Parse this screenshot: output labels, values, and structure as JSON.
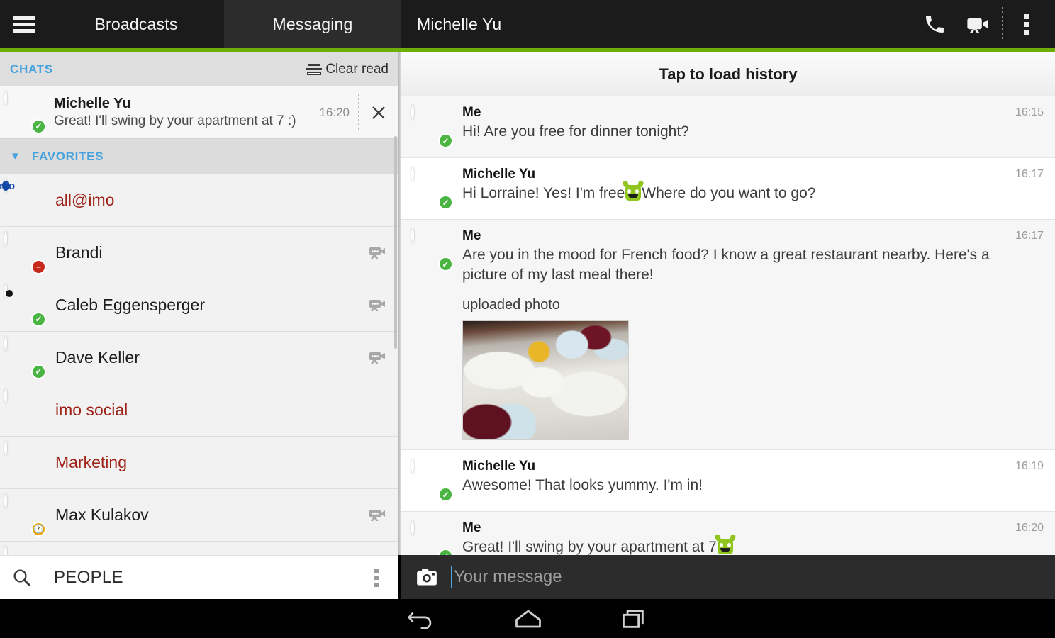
{
  "topbar": {
    "menu_icon": "hamburger-icon",
    "tabs": [
      {
        "label": "Broadcasts",
        "active": false
      },
      {
        "label": "Messaging",
        "active": true
      }
    ],
    "conversation_title": "Michelle  Yu",
    "actions": [
      {
        "name": "voice-call",
        "icon": "phone-icon"
      },
      {
        "name": "video-call",
        "icon": "video-camera-icon"
      },
      {
        "name": "overflow",
        "icon": "more-vertical-icon"
      }
    ]
  },
  "sidebar": {
    "chats_header": {
      "title": "CHATS",
      "clear_read_label": "Clear read",
      "clear_read_icon": "stacked-lines-icon"
    },
    "chats": [
      {
        "name": "Michelle  Yu",
        "preview": "Great! I'll swing by your apartment at 7 :)",
        "time": "16:20",
        "status": "online",
        "avatar": "face-michelle2",
        "close_icon": "close-icon"
      }
    ],
    "favorites_header": {
      "title": "FAVORITES",
      "chevron": "chevron-down-icon"
    },
    "favorites": [
      {
        "name": "all@imo",
        "avatar": "imo-logo",
        "status": "none",
        "red": true,
        "video": false
      },
      {
        "name": "Brandi",
        "avatar": "face-brandi",
        "status": "busy",
        "red": false,
        "video": true
      },
      {
        "name": "Caleb Eggensperger",
        "avatar": "face-caleb",
        "status": "online",
        "red": false,
        "video": true
      },
      {
        "name": "Dave Keller",
        "avatar": "face-dave",
        "status": "online",
        "red": false,
        "video": true
      },
      {
        "name": "imo social",
        "avatar": "face-imosocial",
        "status": "none",
        "red": true,
        "video": false
      },
      {
        "name": "Marketing",
        "avatar": "face-marketing",
        "status": "none",
        "red": true,
        "video": false
      },
      {
        "name": "Max Kulakov",
        "avatar": "face-max",
        "status": "away",
        "red": false,
        "video": true
      }
    ],
    "search": {
      "label": "PEOPLE",
      "icon": "search-icon",
      "overflow_icon": "more-vertical-icon"
    }
  },
  "conversation": {
    "load_history_label": "Tap to load history",
    "messages": [
      {
        "sender": "Me",
        "text": "Hi! Are you free for dinner tonight?",
        "time": "16:15",
        "avatar": "face-me",
        "status": "online",
        "emoji_after": false,
        "photo": false
      },
      {
        "sender": "Michelle  Yu",
        "text_before": "Hi Lorraine! Yes! I'm free",
        "text_after": "Where do you want to go?",
        "time": "16:17",
        "avatar": "face-michelle",
        "status": "online",
        "emoji_inline": true,
        "photo": false
      },
      {
        "sender": "Me",
        "text": "Are you in the mood for French food? I know a great restaurant nearby. Here's a picture of my last meal there!",
        "time": "16:17",
        "avatar": "face-me",
        "status": "online",
        "photo": true,
        "photo_label": "uploaded photo"
      },
      {
        "sender": "Michelle  Yu",
        "text": "Awesome! That looks yummy. I'm in!",
        "time": "16:19",
        "avatar": "face-michelle",
        "status": "online",
        "photo": false
      },
      {
        "sender": "Me",
        "text_before": "Great! I'll swing by your apartment at 7",
        "text_after": "",
        "time": "16:20",
        "avatar": "face-me",
        "status": "online",
        "emoji_inline": true,
        "photo": false
      }
    ],
    "input": {
      "placeholder": "Your message",
      "value": "",
      "camera_icon": "camera-icon"
    }
  },
  "navbar": {
    "items": [
      {
        "name": "back",
        "icon": "back-arrow-icon"
      },
      {
        "name": "home",
        "icon": "home-icon"
      },
      {
        "name": "recents",
        "icon": "recent-apps-icon"
      }
    ]
  },
  "colors": {
    "accent_green": "#6fae09",
    "header_dark": "#1b1b1b",
    "tab_active": "#2c2c2c",
    "link_blue": "#47a3dd",
    "group_red": "#9e2217",
    "status_online": "#4bb543",
    "status_busy": "#c72a1c",
    "status_away": "#eda406",
    "caret_blue": "#4fa3e0"
  }
}
